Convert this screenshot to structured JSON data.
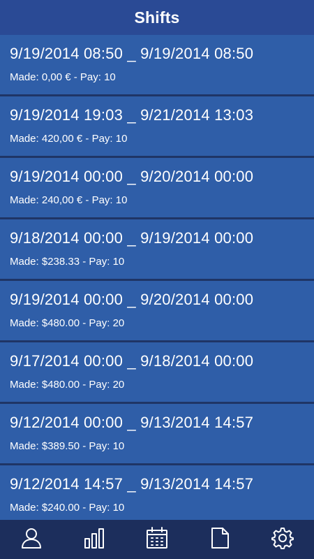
{
  "header": {
    "title": "Shifts"
  },
  "shifts": [
    {
      "range": "9/19/2014 08:50 _ 9/19/2014 08:50",
      "details": "Made: 0,00 € - Pay: 10"
    },
    {
      "range": "9/19/2014 19:03 _ 9/21/2014 13:03",
      "details": "Made: 420,00 € - Pay: 10"
    },
    {
      "range": "9/19/2014 00:00 _ 9/20/2014 00:00",
      "details": "Made: 240,00 € - Pay: 10"
    },
    {
      "range": "9/18/2014 00:00 _ 9/19/2014 00:00",
      "details": "Made: $238.33 - Pay: 10"
    },
    {
      "range": "9/19/2014 00:00 _ 9/20/2014 00:00",
      "details": "Made: $480.00 - Pay: 20"
    },
    {
      "range": "9/17/2014 00:00 _ 9/18/2014 00:00",
      "details": "Made: $480.00 - Pay: 20"
    },
    {
      "range": "9/12/2014 00:00 _ 9/13/2014 14:57",
      "details": "Made: $389.50 - Pay: 10"
    },
    {
      "range": "9/12/2014 14:57 _ 9/13/2014 14:57",
      "details": "Made: $240.00 - Pay: 10"
    }
  ],
  "bottom_nav": [
    {
      "icon": "user-icon"
    },
    {
      "icon": "bar-chart-icon"
    },
    {
      "icon": "calendar-icon"
    },
    {
      "icon": "document-icon"
    },
    {
      "icon": "gear-icon"
    }
  ],
  "colors": {
    "header_bg": "#2a4a95",
    "row_bg": "#2f5ea8",
    "separator": "#1f3566",
    "bottom_bar_bg": "#1c2e5c",
    "text": "#ffffff"
  }
}
